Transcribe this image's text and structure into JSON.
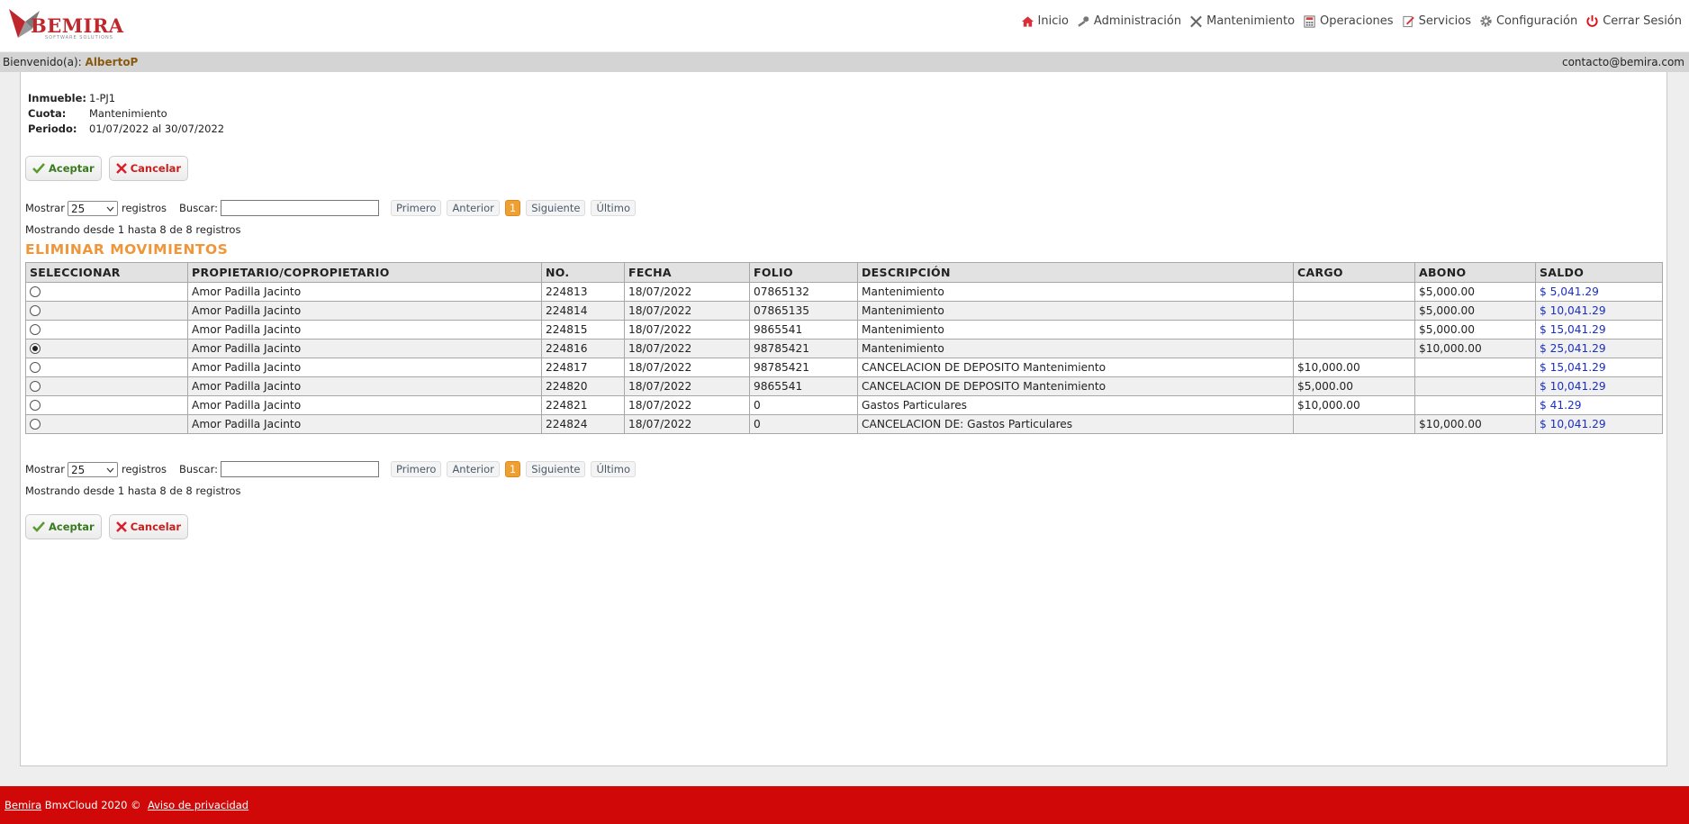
{
  "brand": {
    "name": "BEMIRA",
    "tagline": "SOFTWARE SOLUTIONS",
    "accent": "#c0272d"
  },
  "nav": [
    {
      "label": "Inicio",
      "icon": "home-icon"
    },
    {
      "label": "Administración",
      "icon": "key-icon"
    },
    {
      "label": "Mantenimiento",
      "icon": "tools-icon"
    },
    {
      "label": "Operaciones",
      "icon": "calculator-icon"
    },
    {
      "label": "Servicios",
      "icon": "edit-icon"
    },
    {
      "label": "Configuración",
      "icon": "gear-icon"
    },
    {
      "label": "Cerrar Sesión",
      "icon": "power-icon"
    }
  ],
  "welcome": {
    "prefix": "Bienvenido(a):",
    "user": "AlbertoP",
    "email": "contacto@bemira.com"
  },
  "info": {
    "inmueble_label": "Inmueble:",
    "inmueble": "1-PJ1",
    "cuota_label": "Cuota:",
    "cuota": "Mantenimiento",
    "periodo_label": "Periodo:",
    "periodo": "01/07/2022 al 30/07/2022"
  },
  "buttons": {
    "accept": "Aceptar",
    "cancel": "Cancelar"
  },
  "controls": {
    "show_label": "Mostrar",
    "page_size": "25",
    "records_label": "registros",
    "search_label": "Buscar:",
    "search_value": "",
    "first": "Primero",
    "prev": "Anterior",
    "current_page": "1",
    "next": "Siguiente",
    "last": "Último",
    "status": "Mostrando desde 1 hasta 8 de 8 registros"
  },
  "section_title": "ELIMINAR MOVIMIENTOS",
  "table": {
    "columns": [
      "SELECCIONAR",
      "PROPIETARIO/COPROPIETARIO",
      "NO.",
      "FECHA",
      "FOLIO",
      "DESCRIPCIÓN",
      "CARGO",
      "ABONO",
      "SALDO"
    ],
    "rows": [
      {
        "selected": false,
        "owner": "Amor Padilla Jacinto",
        "no": "224813",
        "date": "18/07/2022",
        "folio": "07865132",
        "desc": "Mantenimiento",
        "cargo": "",
        "abono": "$5,000.00",
        "saldo": "$ 5,041.29"
      },
      {
        "selected": false,
        "owner": "Amor Padilla Jacinto",
        "no": "224814",
        "date": "18/07/2022",
        "folio": "07865135",
        "desc": "Mantenimiento",
        "cargo": "",
        "abono": "$5,000.00",
        "saldo": "$ 10,041.29"
      },
      {
        "selected": false,
        "owner": "Amor Padilla Jacinto",
        "no": "224815",
        "date": "18/07/2022",
        "folio": "9865541",
        "desc": "Mantenimiento",
        "cargo": "",
        "abono": "$5,000.00",
        "saldo": "$ 15,041.29"
      },
      {
        "selected": true,
        "owner": "Amor Padilla Jacinto",
        "no": "224816",
        "date": "18/07/2022",
        "folio": "98785421",
        "desc": "Mantenimiento",
        "cargo": "",
        "abono": "$10,000.00",
        "saldo": "$ 25,041.29"
      },
      {
        "selected": false,
        "owner": "Amor Padilla Jacinto",
        "no": "224817",
        "date": "18/07/2022",
        "folio": "98785421",
        "desc": "CANCELACION DE DEPOSITO Mantenimiento",
        "cargo": "$10,000.00",
        "abono": "",
        "saldo": "$ 15,041.29"
      },
      {
        "selected": false,
        "owner": "Amor Padilla Jacinto",
        "no": "224820",
        "date": "18/07/2022",
        "folio": "9865541",
        "desc": "CANCELACION DE DEPOSITO Mantenimiento",
        "cargo": "$5,000.00",
        "abono": "",
        "saldo": "$ 10,041.29"
      },
      {
        "selected": false,
        "owner": "Amor Padilla Jacinto",
        "no": "224821",
        "date": "18/07/2022",
        "folio": "0",
        "desc": "Gastos Particulares",
        "cargo": "$10,000.00",
        "abono": "",
        "saldo": "$ 41.29"
      },
      {
        "selected": false,
        "owner": "Amor Padilla Jacinto",
        "no": "224824",
        "date": "18/07/2022",
        "folio": "0",
        "desc": "CANCELACION DE: Gastos Particulares",
        "cargo": "",
        "abono": "$10,000.00",
        "saldo": "$ 10,041.29"
      }
    ]
  },
  "footer": {
    "brand_link": "Bemira",
    "text": "BmxCloud 2020 ©",
    "privacy": "Aviso de privacidad",
    "color": "#d10808"
  }
}
